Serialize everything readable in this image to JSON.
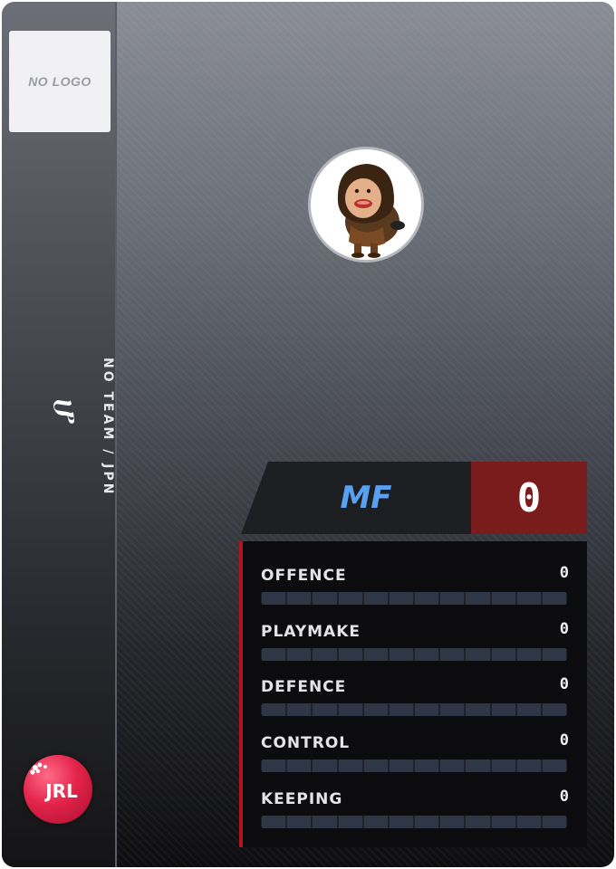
{
  "team": {
    "logo_placeholder": "NO LOGO",
    "label": "NO TEAM / JPN"
  },
  "player": {
    "name": "ሆ",
    "position": "MF",
    "rating": "0"
  },
  "league_badge": "JRL",
  "stats": [
    {
      "label": "OFFENCE",
      "value": "0",
      "fraction": 0
    },
    {
      "label": "PLAYMAKE",
      "value": "0",
      "fraction": 0
    },
    {
      "label": "DEFENCE",
      "value": "0",
      "fraction": 0
    },
    {
      "label": "CONTROL",
      "value": "0",
      "fraction": 0
    },
    {
      "label": "KEEPING",
      "value": "0",
      "fraction": 0
    }
  ],
  "colors": {
    "position_text": "#5aa0f0",
    "rating_bg": "#7a1c1c",
    "stats_accent": "#b3141b"
  },
  "icons": {
    "league": "jrl-badge-icon",
    "avatar": "hooded-character-avatar"
  }
}
